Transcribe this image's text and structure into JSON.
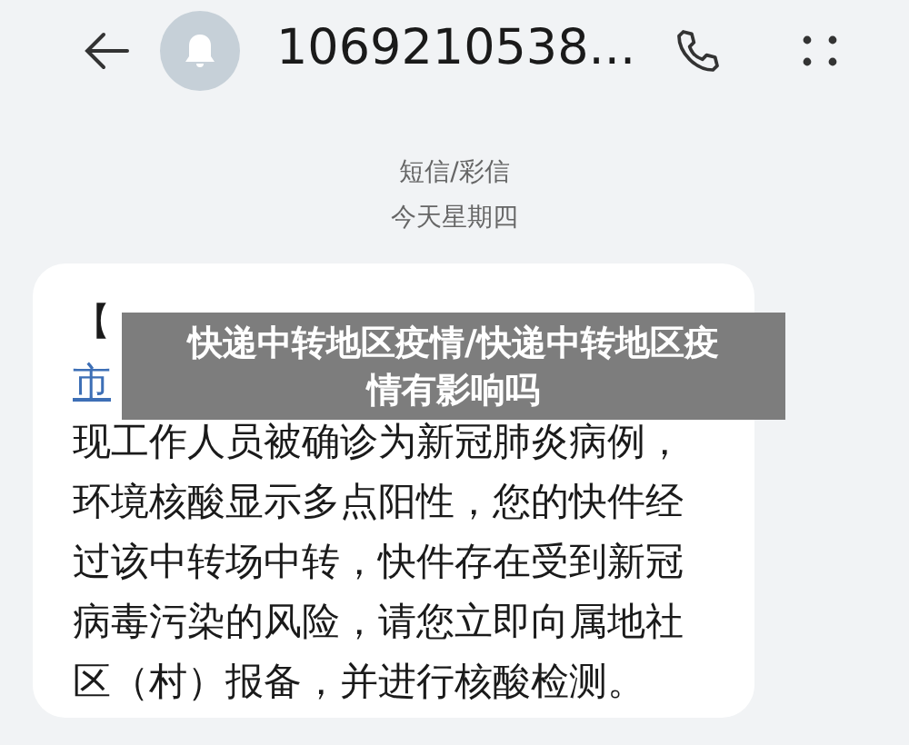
{
  "header": {
    "contact": "1069210538..."
  },
  "conversation": {
    "type": "短信/彩信",
    "day": "今天星期四"
  },
  "message": {
    "lines": [
      {
        "text": "【",
        "link": false
      },
      {
        "text": "市",
        "link": true
      },
      {
        "text": "现工作人员被确诊为新冠肺炎病例，",
        "link": false
      },
      {
        "text": "环境核酸显示多点阳性，您的快件经",
        "link": false
      },
      {
        "text": "过该中转场中转，快件存在受到新冠",
        "link": false
      },
      {
        "text": "病毒污染的风险，请您立即向属地社",
        "link": false
      },
      {
        "text": "区（村）报备，并进行核酸检测。",
        "link": false
      }
    ]
  },
  "overlay_caption": [
    "快递中转地区疫情/快递中转地区疫",
    "情有影响吗"
  ]
}
